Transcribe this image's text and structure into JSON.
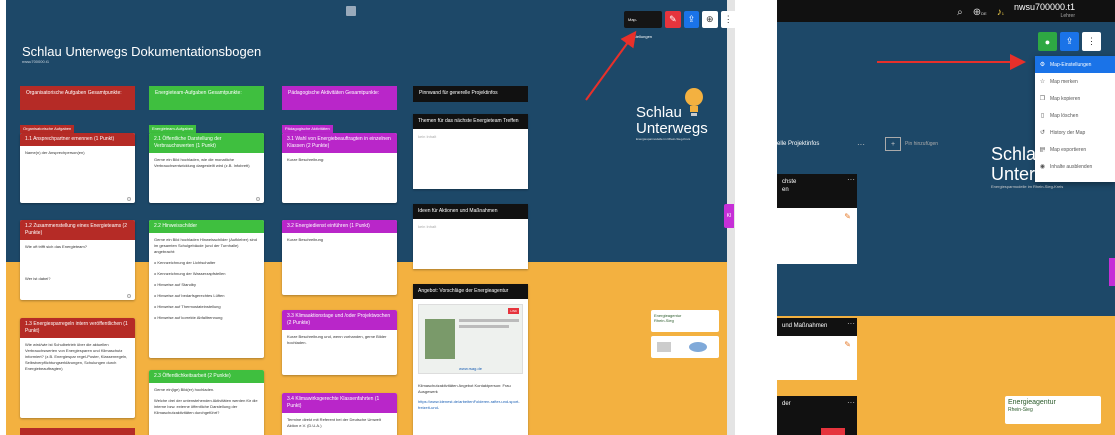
{
  "left": {
    "board_title": "Schlau Unterwegs Dokumentationsbogen",
    "board_subtitle": "nwsu700000.t1",
    "toolbar": {
      "settings_label": "Map-Einstellungen",
      "icons": [
        "pencil-icon",
        "share-icon",
        "zoom-icon",
        "more-icon"
      ]
    },
    "columns": [
      {
        "heading": "Organisatorische Aufgaben Gesamtpunkte:",
        "color": "#b52b26"
      },
      {
        "heading": "Energieteam-Aufgaben Gesamtpunkte:",
        "color": "#3fbf3f"
      },
      {
        "heading": "Pädagogische Aktivitäten Gesamtpunkte:",
        "color": "#b926c9"
      },
      {
        "heading": "Pinnwand für generelle Projektinfos",
        "color": "#111111"
      }
    ],
    "sections": [
      "Organisatorische Aufgaben",
      "Energieteam-Aufgaben",
      "Pädagogische Aktivitäten"
    ],
    "cards": {
      "c1_1": {
        "title": "1.1 Ansprechpartner ernennen (1 Punkt)",
        "body": "Name(n) der Ansprechperson(en)"
      },
      "c1_2": {
        "title": "1.2 Zusammenstellung eines Energieteams (2 Punkte)",
        "body1": "Wie oft trifft sich das Energieteam?",
        "body2": "Wer ist dabei?"
      },
      "c1_3": {
        "title": "1.3 Energiesparregeln intern veröffentlichen (1 Punkt)",
        "body": "Wie wird/wie ist Schulbetrieb über die aktuellen Verbrauchswerten von Energiesparen und Klimaschutz informiert? (z.B. Energiespar regel-Poster, Klassenregeln, Selbstverpflichtungserklärungen, Schulungen durch Energiebeauftragten)"
      },
      "c2_1": {
        "title": "2.1 Öffentliche Darstellung der Verbrauchswerten (1 Punkt)",
        "body": "Gerne ein Bild hochladen, wie die monatliche Verbrauchsentwicklung dargestellt wird (z.B. Infobrett)"
      },
      "c2_2": {
        "title": "2.2 Hinweisschilder",
        "body": "Gerne ein Bild hochladen Hinweisschilder (Aufkleber) sind im gesamten Schulgebäude (und der Turnhalle) angebracht:",
        "items": [
          "o Kennzeichnung der Lichtschalter",
          "o Kennzeichnung der Wasserzapfstellen",
          "o Hinweise auf Standby",
          "o Hinweise auf bedarfsgerechtes Lüften",
          "o Hinweise auf Thermostateinstellung",
          "o Hinweise auf korrekte Abfalltrennung"
        ]
      },
      "c2_3": {
        "title": "2.3 Öffentlichkeitsarbeit (2 Punkte)",
        "body1": "Gerne ein(ige) Bild(er) hochladen.",
        "body2": "Welche drei der untenstehenden Aktivitäten werden für die interne bzw. externe öffentliche Darstellung der Klimaschutzaktivitäten durchgeführt?"
      },
      "c3_1": {
        "title": "3.1 Wahl von Energiebeauftragten in einzelnen Klassen (2 Punkte)",
        "body": "Kurze Beschreibung:"
      },
      "c3_2": {
        "title": "3.2 Energiedienst einführen (1 Punkt)",
        "body": "Kurze Beschreibung"
      },
      "c3_3": {
        "title": "3.3 Klimaaktionstage und /oder Projektwochen (2 Punkte)",
        "body": "Kurze Beschreibung und, wenn vorhanden, gerne Bilder hochladen."
      },
      "c3_4": {
        "title": "3.4 Klimawirksgerechte Klassenfahrten (1 Punkt)",
        "body": "Termine direkt mit Referent bei der Deutsche Umwelt Aktion e.V. (D.U.A.)"
      }
    },
    "pins": {
      "p1": {
        "title": "Themen für das nächste Energieteam Treffen",
        "placeholder": "kein Inhalt"
      },
      "p2": {
        "title": "Ideen für Aktionen und Maßnahmen",
        "placeholder": "kein Inhalt"
      },
      "p3": {
        "title": "Angebot: Vorschläge der Energieagentur",
        "badge": "LINK",
        "caption": "www.rsag.de",
        "footer": "Klimaschutzaktivitäten Angebot Kontaktperson: Frau Ausgewerk",
        "link": "https://www.ldenest.de/arbeitenFolderen-rafter-und-sport-freizeit-und-"
      }
    },
    "logo": {
      "line1": "Schlau",
      "line2": "Unterwegs",
      "tagline": "Energiesparmodelle im Rhein-Sieg-Kreis"
    },
    "ea_logo": {
      "line1": "Energieagentur",
      "line2": "Rhein-Sieg"
    },
    "side_tab": "KI",
    "colors": {
      "background": "#1d4868",
      "band": "#f3b140",
      "red": "#b52b26",
      "green": "#3fbf3f",
      "purple": "#b926c9",
      "black": "#111111",
      "arrow": "#e8302a"
    }
  },
  "right": {
    "user": {
      "name": "nwsu700000.t1",
      "role": "Lehrer"
    },
    "nav_icons": [
      "search-icon",
      "language-icon",
      "bell-icon",
      "user-icon"
    ],
    "lang": "DE",
    "bell_count": "1",
    "toolbar_icons": [
      "eye-icon",
      "share-icon",
      "more-icon"
    ],
    "menu": [
      {
        "label": "Map-Einstellungen",
        "icon": "gear-icon",
        "active": true
      },
      {
        "label": "Map merken",
        "icon": "star-icon"
      },
      {
        "label": "Map kopieren",
        "icon": "copy-icon"
      },
      {
        "label": "Map löschen",
        "icon": "trash-icon"
      },
      {
        "label": "History der Map",
        "icon": "history-icon"
      },
      {
        "label": "Map exportieren",
        "icon": "export-icon"
      },
      {
        "label": "Inhalte ausblenden",
        "icon": "hide-icon"
      }
    ],
    "add_pin": "Pin hinzufügen",
    "frag_header": "elle Projektinfos",
    "frag_next_1": "chste",
    "frag_next_2": "en",
    "frag_ideas": "und Maßnahmen",
    "frag_der": "der",
    "logo": {
      "line1": "Schlau",
      "line2": "Unter",
      "tagline": "Energiesparmodelle im Rhein-Sieg-Kreis"
    },
    "ea_logo": {
      "line1": "Energieagentur",
      "line2": "Rhein-Sieg"
    }
  }
}
